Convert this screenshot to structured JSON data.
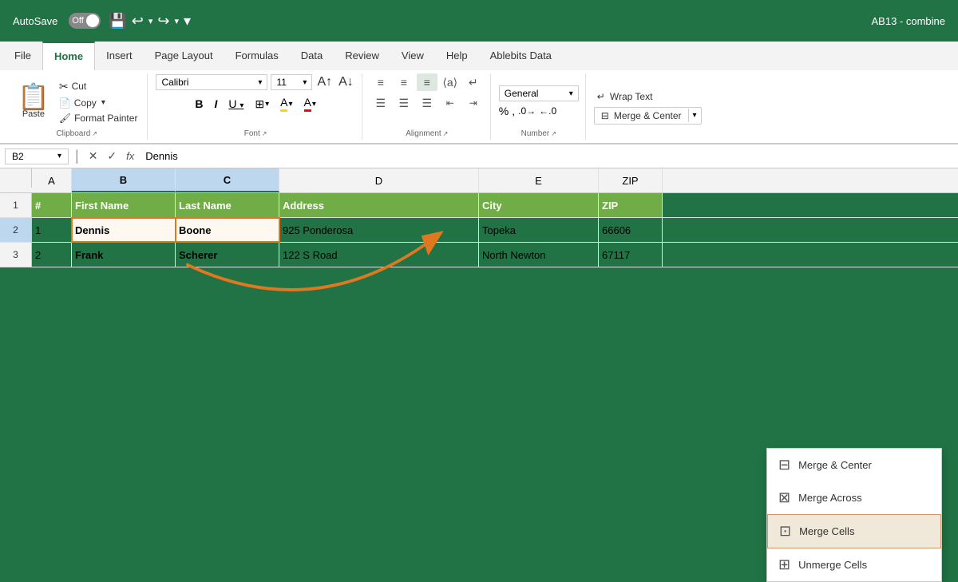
{
  "titlebar": {
    "autosave_label": "AutoSave",
    "toggle_state": "Off",
    "cell_ref_display": "AB13 - combine"
  },
  "ribbon": {
    "tabs": [
      "File",
      "Home",
      "Insert",
      "Page Layout",
      "Formulas",
      "Data",
      "Review",
      "View",
      "Help",
      "Ablebits Data"
    ],
    "active_tab": "Home",
    "groups": {
      "clipboard": {
        "label": "Clipboard",
        "paste_label": "Paste",
        "cut_label": "Cut",
        "copy_label": "Copy",
        "format_painter_label": "Format Painter"
      },
      "font": {
        "label": "Font",
        "font_name": "Calibri",
        "font_size": "11",
        "bold": "B",
        "italic": "I",
        "underline": "U"
      },
      "alignment": {
        "label": "Alignment"
      },
      "number": {
        "label": "Number"
      },
      "wrap": {
        "wrap_text_label": "Wrap Text",
        "merge_center_label": "Merge & Center"
      }
    }
  },
  "formula_bar": {
    "cell_ref": "B2",
    "formula_value": "Dennis"
  },
  "spreadsheet": {
    "col_headers": [
      "A",
      "B",
      "C",
      "D",
      "E",
      "ZIP"
    ],
    "rows": [
      {
        "row_num": "1",
        "is_header": true,
        "cells": [
          "#",
          "First Name",
          "Last Name",
          "Address",
          "City",
          "ZIP"
        ]
      },
      {
        "row_num": "2",
        "is_header": false,
        "selected": true,
        "cells": [
          "1",
          "Dennis",
          "Boone",
          "925 Ponderosa",
          "Topeka",
          "66606"
        ]
      },
      {
        "row_num": "3",
        "is_header": false,
        "selected": false,
        "cells": [
          "2",
          "Frank",
          "Scherer",
          "122 S Road",
          "North Newton",
          "67117"
        ]
      }
    ]
  },
  "merge_dropdown": {
    "items": [
      {
        "label": "Merge & Center",
        "id": "merge-center"
      },
      {
        "label": "Merge Across",
        "id": "merge-across"
      },
      {
        "label": "Merge Cells",
        "id": "merge-cells",
        "highlighted": true
      },
      {
        "label": "Unmerge Cells",
        "id": "unmerge-cells"
      }
    ]
  }
}
